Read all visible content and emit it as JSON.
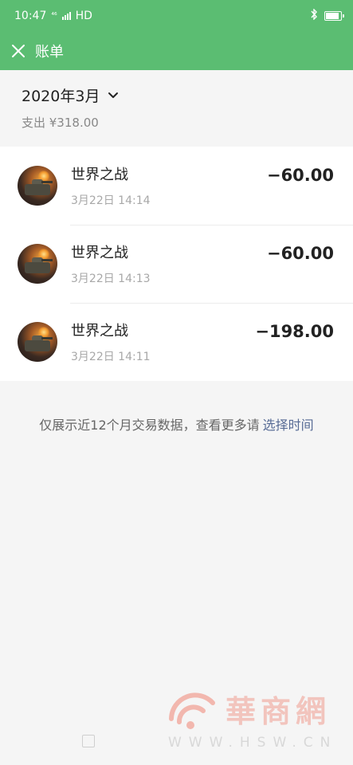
{
  "status_bar": {
    "time": "10:47",
    "network": "HD",
    "network_prefix": "⁴⁶"
  },
  "app_bar": {
    "title": "账单"
  },
  "summary": {
    "month": "2020年3月",
    "expense": "支出 ¥318.00"
  },
  "transactions": [
    {
      "name": "世界之战",
      "time": "3月22日 14:14",
      "amount": "−60.00"
    },
    {
      "name": "世界之战",
      "time": "3月22日 14:13",
      "amount": "−60.00"
    },
    {
      "name": "世界之战",
      "time": "3月22日 14:11",
      "amount": "−198.00"
    }
  ],
  "footer_note": {
    "text": "仅展示近12个月交易数据，查看更多请",
    "link": "选择时间"
  },
  "watermark": {
    "chars": "華商網",
    "url": "WWW.HSW.CN"
  },
  "colors": {
    "primary": "#5bbd72",
    "link": "#576b95",
    "background": "#f5f5f5"
  },
  "icons": [
    "close-icon",
    "chevron-down-icon",
    "bluetooth-icon",
    "battery-icon",
    "signal-icon"
  ]
}
